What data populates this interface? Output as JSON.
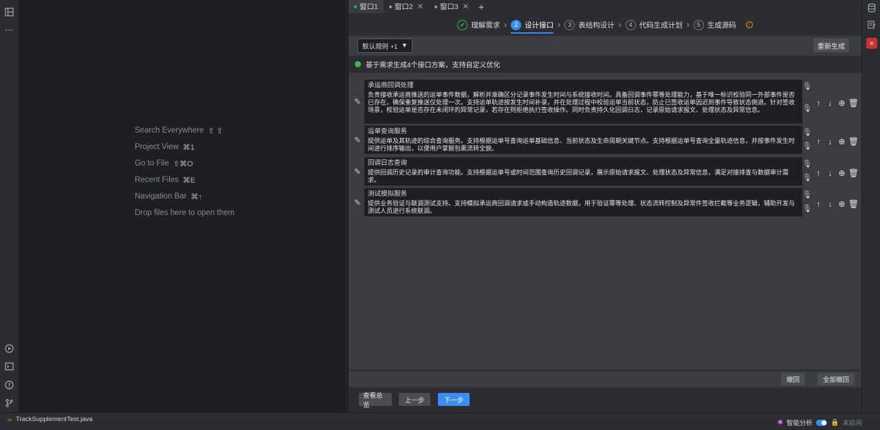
{
  "left_strip": {
    "icons": [
      "project-structure-icon",
      "more-icon",
      "run-icon",
      "terminal-icon",
      "problems-icon",
      "git-icon"
    ]
  },
  "editor_hints": [
    {
      "label": "Search Everywhere",
      "keys": "⇧ ⇧"
    },
    {
      "label": "Project View",
      "keys": "⌘1"
    },
    {
      "label": "Go to File",
      "keys": "⇧⌘O"
    },
    {
      "label": "Recent Files",
      "keys": "⌘E"
    },
    {
      "label": "Navigation Bar",
      "keys": "⌘↑"
    },
    {
      "label": "Drop files here to open them",
      "keys": ""
    }
  ],
  "tabs": [
    {
      "label": "窗口1",
      "active": true
    },
    {
      "label": "窗口2",
      "active": false
    },
    {
      "label": "窗口3",
      "active": false
    }
  ],
  "steps": [
    {
      "num": "✔",
      "label": "理解需求",
      "state": "done"
    },
    {
      "num": "2",
      "label": "设计接口",
      "state": "current"
    },
    {
      "num": "3",
      "label": "表结构设计",
      "state": "todo"
    },
    {
      "num": "4",
      "label": "代码生成计划",
      "state": "todo"
    },
    {
      "num": "5",
      "label": "生成源码",
      "state": "todo"
    }
  ],
  "toolbar": {
    "rule_select": "默认规则 +1",
    "regenerate": "重新生成"
  },
  "status_text": "基于需求生成4个接口方案，支持自定义优化",
  "items": [
    {
      "title": "承运商回调处理",
      "desc": "负责接收承运商推送的运单事件数据，解析并准确区分记录事件发生时间与系统接收时间。具备回调事件幂等处理能力，基于唯一标识校验同一外部事件是否已存在，确保重复推送仅处理一次。支持运单轨迹按发生时间补录，并在处理过程中校验运单当前状态，防止已签收运单因迟到事件导致状态倒退。针对签收场景，校验运单是否存在未闭环的异常记录，若存在则拒绝执行签收操作。同时负责持久化回调日志，记录原始请求报文、处理状态及异常信息。"
    },
    {
      "title": "运单查询服务",
      "desc": "提供运单及其轨迹的综合查询服务。支持根据运单号查询运单基础信息、当前状态及生命周期关键节点。支持根据运单号查询全量轨迹信息，并按事件发生时间进行排序输出，以便用户掌握包裹流转全貌。"
    },
    {
      "title": "回调日志查询",
      "desc": "提供回调历史记录的审计查询功能。支持根据运单号或时间范围查询历史回调记录，展示原始请求报文、处理状态及异常信息，满足对接排查与数据审计需求。"
    },
    {
      "title": "测试模拟服务",
      "desc": "提供业务验证与联调测试支持。支持模拟承运商回调请求或手动构造轨迹数据，用于验证幂等处理、状态流转控制及异常件签收拦截等业务逻辑，辅助开发与测试人员进行系统联调。"
    }
  ],
  "bottom": {
    "undo": "撤回",
    "undo_all": "全部撤回"
  },
  "footer": {
    "overview": "查看总览",
    "prev": "上一步",
    "next": "下一步"
  },
  "statusbar": {
    "file": "TrackSupplementTest.java",
    "smart_analysis": "智能分析",
    "disabled": "未启用"
  },
  "colors": {
    "accent": "#3b8cf5",
    "success": "#3fb25a",
    "warning": "#e0a30b"
  }
}
